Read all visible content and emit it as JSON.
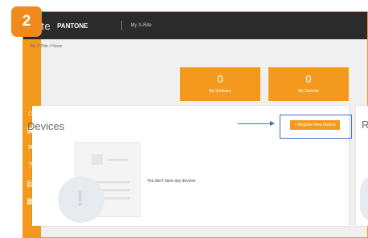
{
  "step_badge": "2",
  "topbar": {
    "logo_text": "rite",
    "brand": "PANTONE",
    "nav_item": "My X-Rite"
  },
  "sidebar": {
    "items": [
      {
        "icon": "home-icon"
      },
      {
        "icon": "device-icon"
      },
      {
        "icon": "tools-icon"
      },
      {
        "icon": "info-icon"
      },
      {
        "icon": "list-icon"
      },
      {
        "icon": "grid-icon"
      }
    ]
  },
  "breadcrumb": "My X-Rite / Home",
  "tiles": [
    {
      "value": "0",
      "label": "My Software"
    },
    {
      "value": "0",
      "label": "My Devices"
    }
  ],
  "devices_card": {
    "title": "Devices",
    "add_button": "+ Register New Device",
    "empty_message": "You don't have any devices"
  },
  "right_card": {
    "title": "R"
  },
  "colors": {
    "accent": "#f39a1e",
    "topbar": "#2b2b2b",
    "highlight": "#3d6fcf"
  }
}
